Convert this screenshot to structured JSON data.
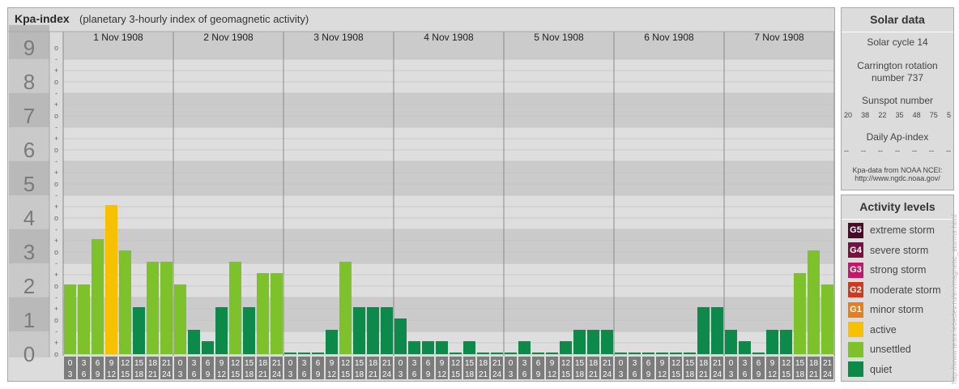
{
  "header": {
    "title": "Kpa-index",
    "subtitle": "(planetary 3-hourly index of geomagnetic activity)"
  },
  "chart_data": {
    "type": "bar",
    "title": "Kpa-index",
    "subtitle": "(planetary 3-hourly index of geomagnetic activity)",
    "ylim": [
      0,
      9
    ],
    "y_major_ticks": [
      "0",
      "1",
      "2",
      "3",
      "4",
      "5",
      "6",
      "7",
      "8",
      "9"
    ],
    "y_minor_ticks": [
      "-",
      "o",
      "+"
    ],
    "days": [
      "1 Nov 1908",
      "2 Nov 1908",
      "3 Nov 1908",
      "4 Nov 1908",
      "5 Nov 1908",
      "6 Nov 1908",
      "7 Nov 1908"
    ],
    "interval_start": [
      "0",
      "3",
      "6",
      "9",
      "12",
      "15",
      "18",
      "21"
    ],
    "interval_end": [
      "3",
      "6",
      "9",
      "12",
      "15",
      "18",
      "21",
      "24"
    ],
    "values": [
      [
        2,
        2,
        3.333,
        4.333,
        3,
        1.333,
        2.667,
        2.667
      ],
      [
        2,
        0.667,
        0.333,
        1.333,
        2.667,
        1.333,
        2.333,
        2.333
      ],
      [
        0,
        0,
        0,
        0.667,
        2.667,
        1.333,
        1.333,
        1.333
      ],
      [
        1,
        0.333,
        0.333,
        0.333,
        0,
        0.333,
        0,
        0
      ],
      [
        0,
        0.333,
        0,
        0,
        0.333,
        0.667,
        0.667,
        0.667
      ],
      [
        0,
        0,
        0,
        0,
        0,
        0,
        1.333,
        1.333
      ],
      [
        0.667,
        0.333,
        0,
        0.667,
        0.667,
        2.333,
        3,
        2
      ]
    ],
    "level_colors": {
      "quiet": "#0d8a4a",
      "unsettled": "#7dc22a",
      "active": "#f7c000"
    }
  },
  "solar": {
    "title": "Solar data",
    "cycle": "Solar cycle 14",
    "carrington_1": "Carrington rotation",
    "carrington_2": "number 737",
    "sunspot_title": "Sunspot number",
    "sunspots": [
      "20",
      "38",
      "22",
      "35",
      "48",
      "75",
      "5"
    ],
    "ap_title": "Daily Ap-index",
    "ap_values": [
      "--",
      "--",
      "--",
      "--",
      "--",
      "--",
      "--"
    ],
    "source_1": "Kpa-data from NOAA NCEI:",
    "source_2": "http://www.ngdc.noaa.gov/"
  },
  "activity": {
    "title": "Activity levels",
    "levels": [
      {
        "badge": "G5",
        "label": "extreme storm",
        "color": "#4a0a2a"
      },
      {
        "badge": "G4",
        "label": "severe storm",
        "color": "#7a1040"
      },
      {
        "badge": "G3",
        "label": "strong storm",
        "color": "#c0186a"
      },
      {
        "badge": "G2",
        "label": "moderate storm",
        "color": "#d2391c"
      },
      {
        "badge": "G1",
        "label": "minor storm",
        "color": "#e77e1a"
      },
      {
        "badge": "",
        "label": "active",
        "color": "#f7c000"
      },
      {
        "badge": "",
        "label": "unsettled",
        "color": "#7dc22a"
      },
      {
        "badge": "",
        "label": "quiet",
        "color": "#0d8a4a"
      }
    ]
  },
  "credit": "http://www.tesis.lebedev.ru/en/magnetic_storms.html"
}
